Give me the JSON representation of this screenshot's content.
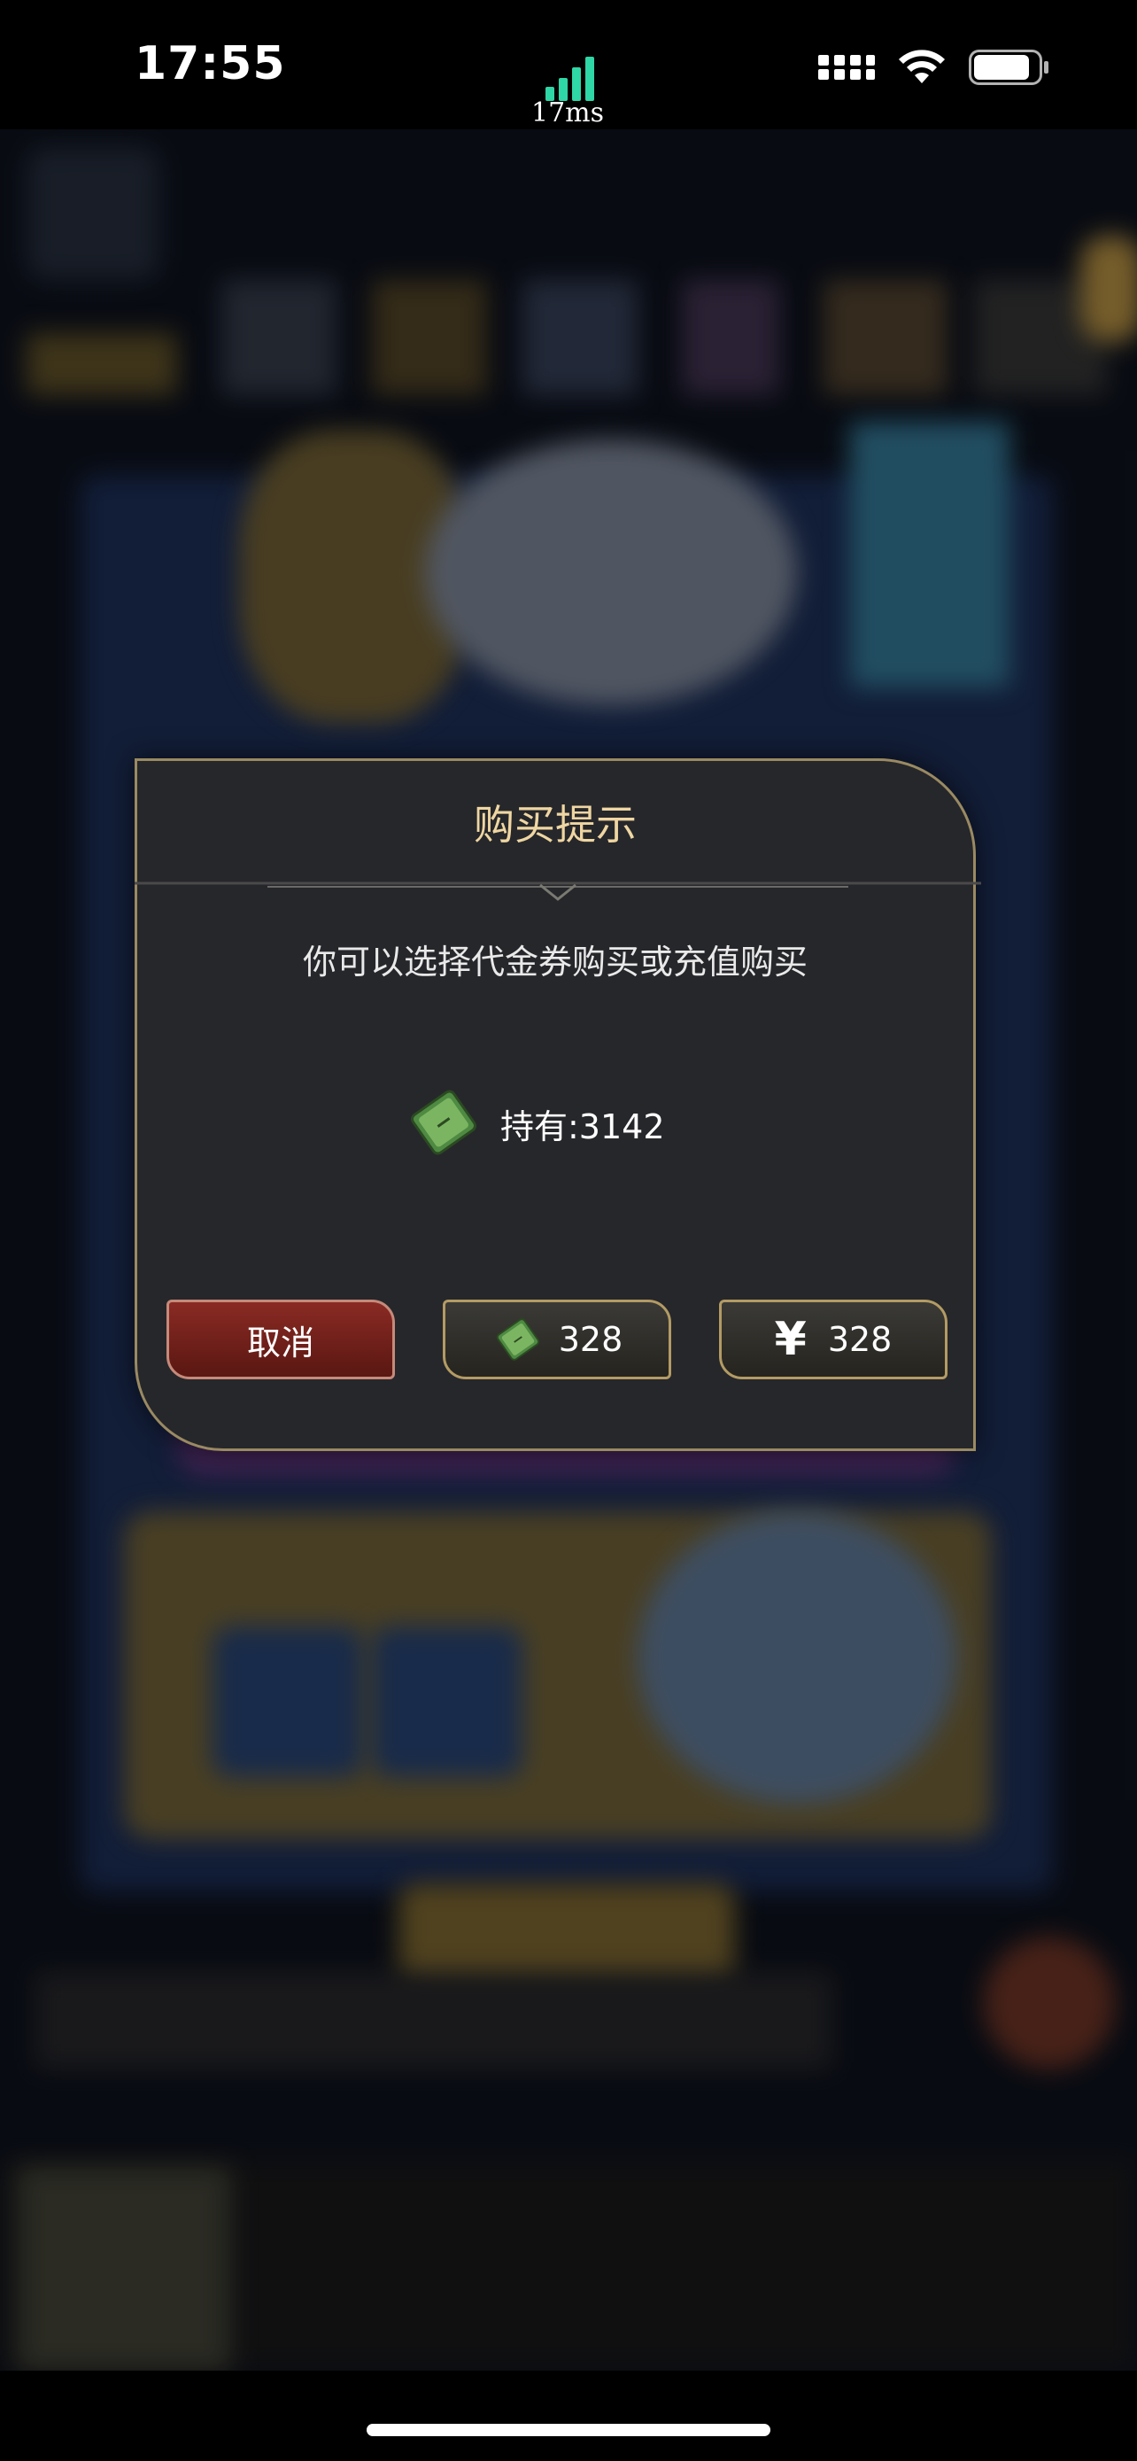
{
  "status_bar": {
    "time": "17:55",
    "ping": "17ms",
    "icons": [
      "cellular-icon",
      "wifi-icon",
      "battery-icon"
    ]
  },
  "dialog": {
    "title": "购买提示",
    "message": "你可以选择代金券购买或充值购买",
    "holding_label": "持有:3142",
    "buttons": {
      "cancel": "取消",
      "voucher_price": "328",
      "yuan_symbol": "¥",
      "yuan_price": "328"
    }
  },
  "colors": {
    "title": "#efd6a2",
    "cancel_button": "#7a241e",
    "border_gold": "#9a8a62",
    "ping_green": "#2fd6a6"
  }
}
